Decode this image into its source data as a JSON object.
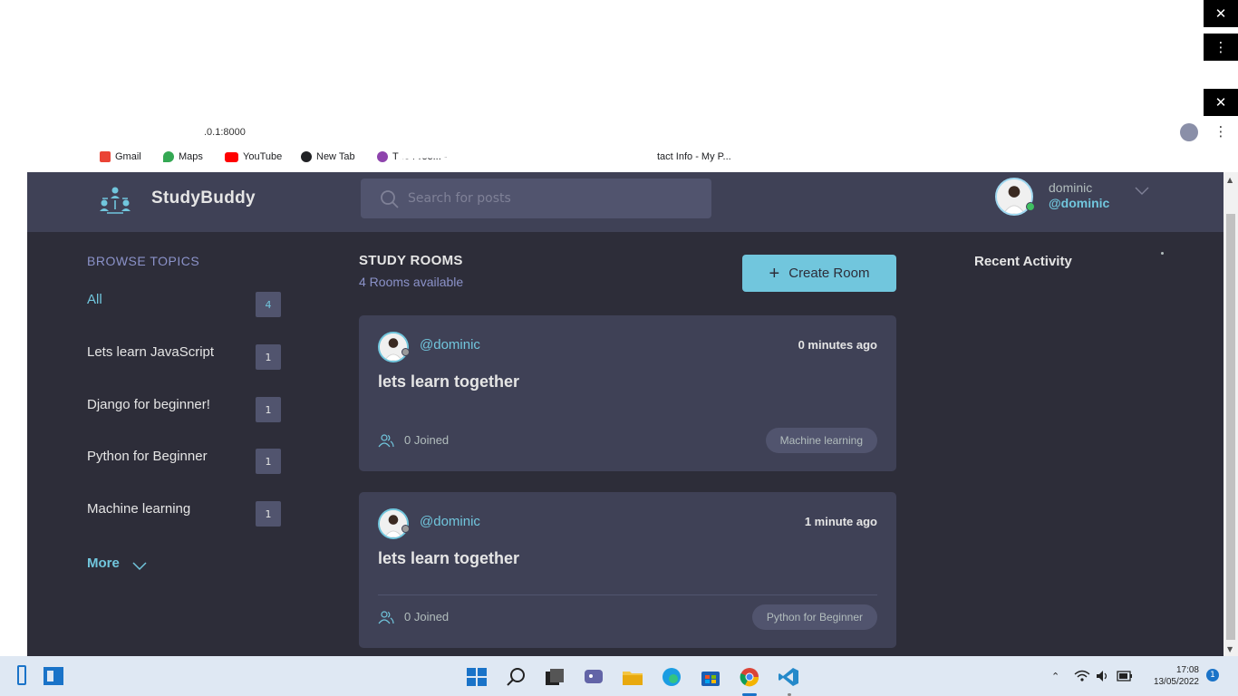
{
  "browser": {
    "url_fragment": ".0.1:8000",
    "bookmarks": [
      {
        "label": "Gmail",
        "color": "#ea4335"
      },
      {
        "label": "Maps",
        "color": "#34a853"
      },
      {
        "label": "YouTube",
        "color": "#ff0000"
      },
      {
        "label": "New Tab",
        "color": "#202124"
      },
      {
        "label": "The Free... - ",
        "color": "#8e44ad"
      },
      {
        "label": "tact Info - My P...",
        "color": "#ea4335"
      }
    ]
  },
  "header": {
    "brand": "StudyBuddy",
    "search_placeholder": "Search for posts",
    "user_name": "dominic",
    "user_handle": "@dominic"
  },
  "sidebar": {
    "title": "BROWSE TOPICS",
    "topics": [
      {
        "label": "All",
        "count": "4"
      },
      {
        "label": "Lets learn JavaScript",
        "count": "1"
      },
      {
        "label": "Django for beginner!",
        "count": "1"
      },
      {
        "label": "Python for Beginner",
        "count": "1"
      },
      {
        "label": "Machine learning",
        "count": "1"
      }
    ],
    "more_label": "More"
  },
  "main": {
    "title": "STUDY ROOMS",
    "subtitle": "4 Rooms available",
    "create_label": "Create Room",
    "rooms": [
      {
        "host": "@dominic",
        "time": "0 minutes ago",
        "title": "lets learn together",
        "joined": "0 Joined",
        "topic": "Machine learning"
      },
      {
        "host": "@dominic",
        "time": "1 minute ago",
        "title": "lets learn together",
        "joined": "0 Joined",
        "topic": "Python for Beginner"
      }
    ]
  },
  "activity": {
    "title": "Recent Activity"
  },
  "taskbar": {
    "time": "17:08",
    "date": "13/05/2022",
    "notification_count": "1"
  },
  "colors": {
    "app_bg": "#2d2d39",
    "panel_bg": "#3f4156",
    "accent": "#71c6dd",
    "muted": "#8b92c9",
    "online": "#3fc061"
  }
}
